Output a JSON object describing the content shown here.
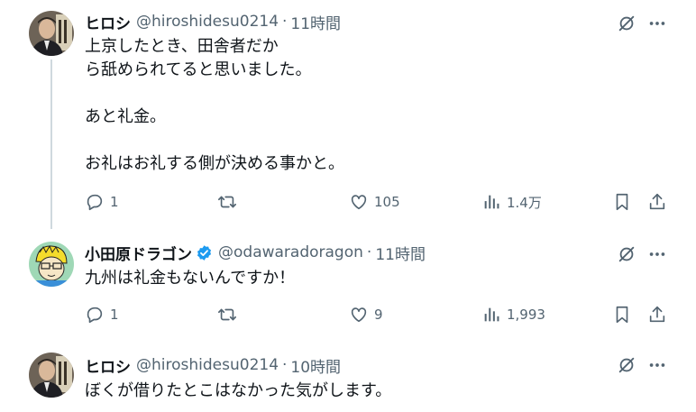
{
  "tweets": [
    {
      "name": "ヒロシ",
      "handle": "@hiroshidesu0214",
      "separator": "·",
      "time": "11時間",
      "text": "上京したとき、田舎者だか\nら舐められてると思いました。\n\nあと礼金。\n\nお礼はお礼する側が決める事かと。",
      "replies": "1",
      "retweets": "",
      "likes": "105",
      "views": "1.4万"
    },
    {
      "name": "小田原ドラゴン",
      "handle": "@odawaradoragon",
      "separator": "·",
      "time": "11時間",
      "text": "九州は礼金もないんですか！",
      "replies": "1",
      "retweets": "",
      "likes": "9",
      "views": "1,993"
    },
    {
      "name": "ヒロシ",
      "handle": "@hiroshidesu0214",
      "separator": "·",
      "time": "10時間",
      "text": "ぼくが借りたとこはなかった気がします。"
    }
  ],
  "icons": {
    "grok": "grok-icon",
    "more": "more-icon",
    "reply": "reply-icon",
    "retweet": "retweet-icon",
    "like": "like-icon",
    "views": "views-icon",
    "bookmark": "bookmark-icon",
    "share": "share-icon",
    "verified": "verified-badge-icon"
  },
  "colors": {
    "text": "#0f1419",
    "secondary": "#536471",
    "verified": "#1d9bf0",
    "thread_line": "#cfd9de"
  }
}
